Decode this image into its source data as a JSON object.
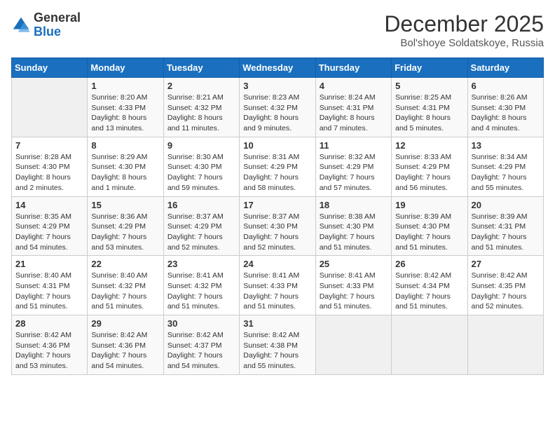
{
  "header": {
    "logo_general": "General",
    "logo_blue": "Blue",
    "month_title": "December 2025",
    "location": "Bol'shoye Soldatskoye, Russia"
  },
  "days_of_week": [
    "Sunday",
    "Monday",
    "Tuesday",
    "Wednesday",
    "Thursday",
    "Friday",
    "Saturday"
  ],
  "weeks": [
    [
      {
        "day": "",
        "empty": true
      },
      {
        "day": "1",
        "sunrise": "8:20 AM",
        "sunset": "4:33 PM",
        "daylight": "8 hours and 13 minutes."
      },
      {
        "day": "2",
        "sunrise": "8:21 AM",
        "sunset": "4:32 PM",
        "daylight": "8 hours and 11 minutes."
      },
      {
        "day": "3",
        "sunrise": "8:23 AM",
        "sunset": "4:32 PM",
        "daylight": "8 hours and 9 minutes."
      },
      {
        "day": "4",
        "sunrise": "8:24 AM",
        "sunset": "4:31 PM",
        "daylight": "8 hours and 7 minutes."
      },
      {
        "day": "5",
        "sunrise": "8:25 AM",
        "sunset": "4:31 PM",
        "daylight": "8 hours and 5 minutes."
      },
      {
        "day": "6",
        "sunrise": "8:26 AM",
        "sunset": "4:30 PM",
        "daylight": "8 hours and 4 minutes."
      }
    ],
    [
      {
        "day": "7",
        "sunrise": "8:28 AM",
        "sunset": "4:30 PM",
        "daylight": "8 hours and 2 minutes."
      },
      {
        "day": "8",
        "sunrise": "8:29 AM",
        "sunset": "4:30 PM",
        "daylight": "8 hours and 1 minute."
      },
      {
        "day": "9",
        "sunrise": "8:30 AM",
        "sunset": "4:30 PM",
        "daylight": "7 hours and 59 minutes."
      },
      {
        "day": "10",
        "sunrise": "8:31 AM",
        "sunset": "4:29 PM",
        "daylight": "7 hours and 58 minutes."
      },
      {
        "day": "11",
        "sunrise": "8:32 AM",
        "sunset": "4:29 PM",
        "daylight": "7 hours and 57 minutes."
      },
      {
        "day": "12",
        "sunrise": "8:33 AM",
        "sunset": "4:29 PM",
        "daylight": "7 hours and 56 minutes."
      },
      {
        "day": "13",
        "sunrise": "8:34 AM",
        "sunset": "4:29 PM",
        "daylight": "7 hours and 55 minutes."
      }
    ],
    [
      {
        "day": "14",
        "sunrise": "8:35 AM",
        "sunset": "4:29 PM",
        "daylight": "7 hours and 54 minutes."
      },
      {
        "day": "15",
        "sunrise": "8:36 AM",
        "sunset": "4:29 PM",
        "daylight": "7 hours and 53 minutes."
      },
      {
        "day": "16",
        "sunrise": "8:37 AM",
        "sunset": "4:29 PM",
        "daylight": "7 hours and 52 minutes."
      },
      {
        "day": "17",
        "sunrise": "8:37 AM",
        "sunset": "4:30 PM",
        "daylight": "7 hours and 52 minutes."
      },
      {
        "day": "18",
        "sunrise": "8:38 AM",
        "sunset": "4:30 PM",
        "daylight": "7 hours and 51 minutes."
      },
      {
        "day": "19",
        "sunrise": "8:39 AM",
        "sunset": "4:30 PM",
        "daylight": "7 hours and 51 minutes."
      },
      {
        "day": "20",
        "sunrise": "8:39 AM",
        "sunset": "4:31 PM",
        "daylight": "7 hours and 51 minutes."
      }
    ],
    [
      {
        "day": "21",
        "sunrise": "8:40 AM",
        "sunset": "4:31 PM",
        "daylight": "7 hours and 51 minutes."
      },
      {
        "day": "22",
        "sunrise": "8:40 AM",
        "sunset": "4:32 PM",
        "daylight": "7 hours and 51 minutes."
      },
      {
        "day": "23",
        "sunrise": "8:41 AM",
        "sunset": "4:32 PM",
        "daylight": "7 hours and 51 minutes."
      },
      {
        "day": "24",
        "sunrise": "8:41 AM",
        "sunset": "4:33 PM",
        "daylight": "7 hours and 51 minutes."
      },
      {
        "day": "25",
        "sunrise": "8:41 AM",
        "sunset": "4:33 PM",
        "daylight": "7 hours and 51 minutes."
      },
      {
        "day": "26",
        "sunrise": "8:42 AM",
        "sunset": "4:34 PM",
        "daylight": "7 hours and 51 minutes."
      },
      {
        "day": "27",
        "sunrise": "8:42 AM",
        "sunset": "4:35 PM",
        "daylight": "7 hours and 52 minutes."
      }
    ],
    [
      {
        "day": "28",
        "sunrise": "8:42 AM",
        "sunset": "4:36 PM",
        "daylight": "7 hours and 53 minutes."
      },
      {
        "day": "29",
        "sunrise": "8:42 AM",
        "sunset": "4:36 PM",
        "daylight": "7 hours and 54 minutes."
      },
      {
        "day": "30",
        "sunrise": "8:42 AM",
        "sunset": "4:37 PM",
        "daylight": "7 hours and 54 minutes."
      },
      {
        "day": "31",
        "sunrise": "8:42 AM",
        "sunset": "4:38 PM",
        "daylight": "7 hours and 55 minutes."
      },
      {
        "day": "",
        "empty": true
      },
      {
        "day": "",
        "empty": true
      },
      {
        "day": "",
        "empty": true
      }
    ]
  ]
}
